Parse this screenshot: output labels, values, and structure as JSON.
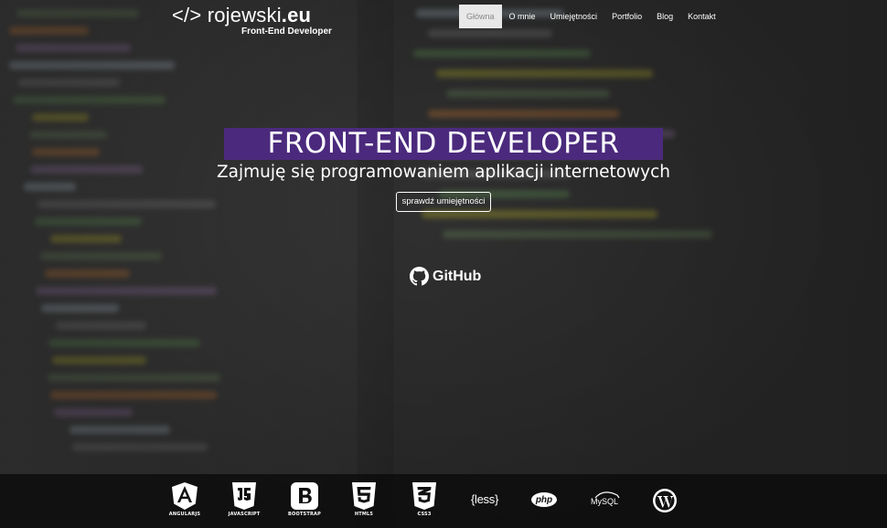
{
  "logo": {
    "prefix": "</> rojewski",
    "tld": ".eu",
    "tagline": "Front-End Developer"
  },
  "nav": [
    {
      "label": "Główna",
      "active": true
    },
    {
      "label": "O mnie"
    },
    {
      "label": "Umiejętności"
    },
    {
      "label": "Portfolio"
    },
    {
      "label": "Blog"
    },
    {
      "label": "Kontakt"
    }
  ],
  "hero": {
    "title": "FRONT-END DEVELOPER",
    "subtitle": "Zajmuję się programowaniem aplikacji internetowych",
    "cta": "sprawdź umiejętności",
    "github": "GitHub"
  },
  "technologies": [
    {
      "icon": "angularjs-icon",
      "label": "ANGULARJS"
    },
    {
      "icon": "javascript-icon",
      "label": "JAVASCRIPT"
    },
    {
      "icon": "bootstrap-icon",
      "label": "BOOTSTRAP"
    },
    {
      "icon": "html5-icon",
      "label": "HTML5"
    },
    {
      "icon": "css3-icon",
      "label": "CSS3"
    },
    {
      "icon": "less-icon",
      "text": "{less}"
    },
    {
      "icon": "php-icon",
      "text": "php"
    },
    {
      "icon": "mysql-icon",
      "text": "MySQL"
    },
    {
      "icon": "wordpress-icon"
    }
  ],
  "colors": {
    "accent": "#4b2a7d",
    "nav_active_bg": "#e8e8e8",
    "nav_active_text": "#888888"
  }
}
